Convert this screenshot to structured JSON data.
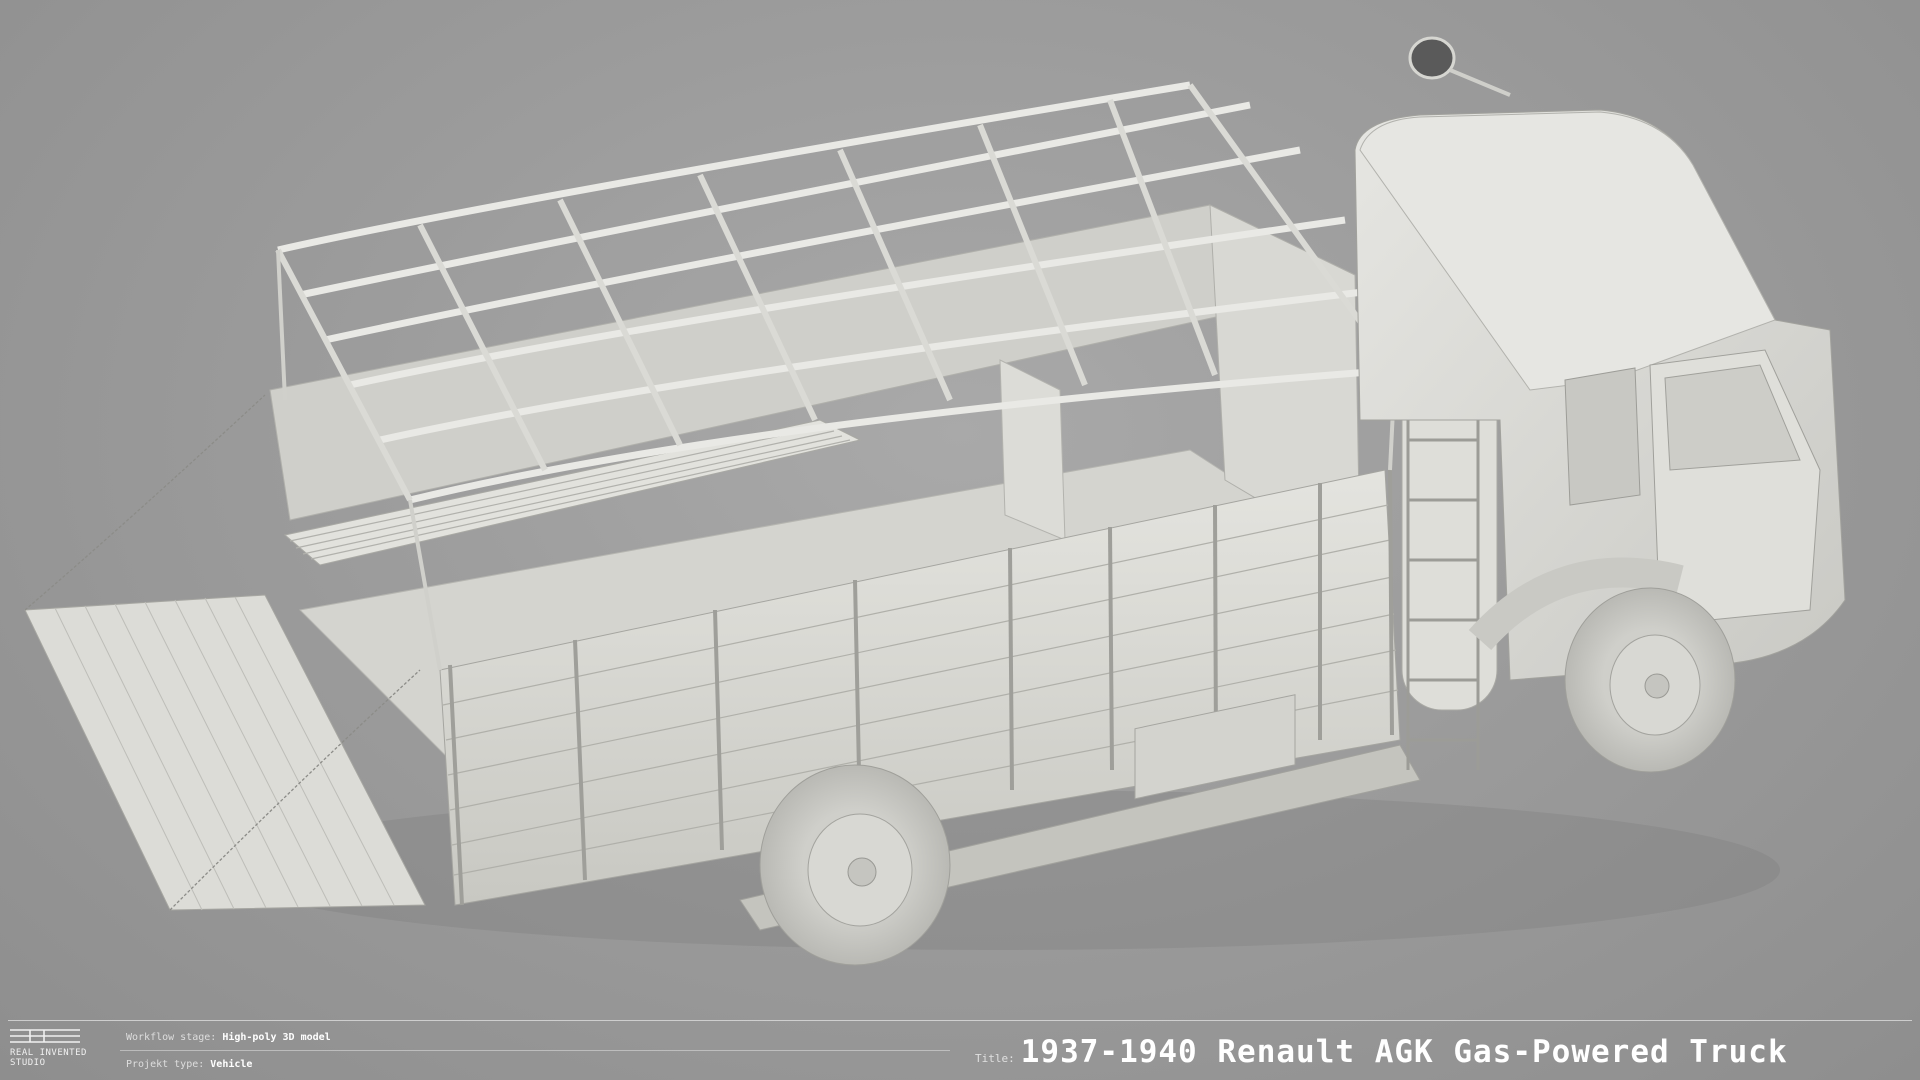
{
  "logo": {
    "line1": "REAL INVENTED",
    "line2": "STUDIO"
  },
  "meta": {
    "workflow_label": "Workflow stage:",
    "workflow_value": "High-poly 3D model",
    "project_label": "Projekt type:",
    "project_value": "Vehicle"
  },
  "title": {
    "label": "Title:",
    "text": "1937-1940 Renault AGK Gas-Powered Truck"
  },
  "colors": {
    "background": "#9e9e9e",
    "model": "#d9d9d4",
    "text": "#ffffff"
  }
}
